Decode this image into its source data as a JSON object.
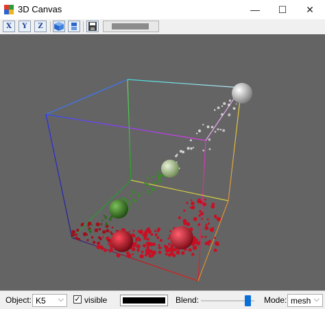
{
  "window": {
    "title": "3D Canvas",
    "minimize_glyph": "—",
    "maximize_glyph": "☐",
    "close_glyph": "✕"
  },
  "toolbar": {
    "view_x": "X",
    "view_y": "Y",
    "view_z": "Z",
    "icons": [
      "x-axis-view-icon",
      "y-axis-view-icon",
      "z-axis-view-icon",
      "cube-icon",
      "layers-icon",
      "save-icon"
    ]
  },
  "canvas": {
    "background": "#646464",
    "spheres": [
      {
        "name": "white-sphere",
        "color": "#e6e6e6"
      },
      {
        "name": "light-green-sphere",
        "color": "#c7ddb0"
      },
      {
        "name": "dark-green-sphere",
        "color": "#3f8d22"
      },
      {
        "name": "red-sphere-left",
        "color": "#d8162a"
      },
      {
        "name": "red-sphere-right",
        "color": "#ea1d34"
      }
    ]
  },
  "status": {
    "object_label": "Object:",
    "object_value": "K5",
    "visible_label": "visible",
    "visible_checked": true,
    "color_value": "#000000",
    "blend_label": "Blend:",
    "blend_level": 0.9,
    "mode_label": "Mode:",
    "mode_value": "mesh"
  }
}
